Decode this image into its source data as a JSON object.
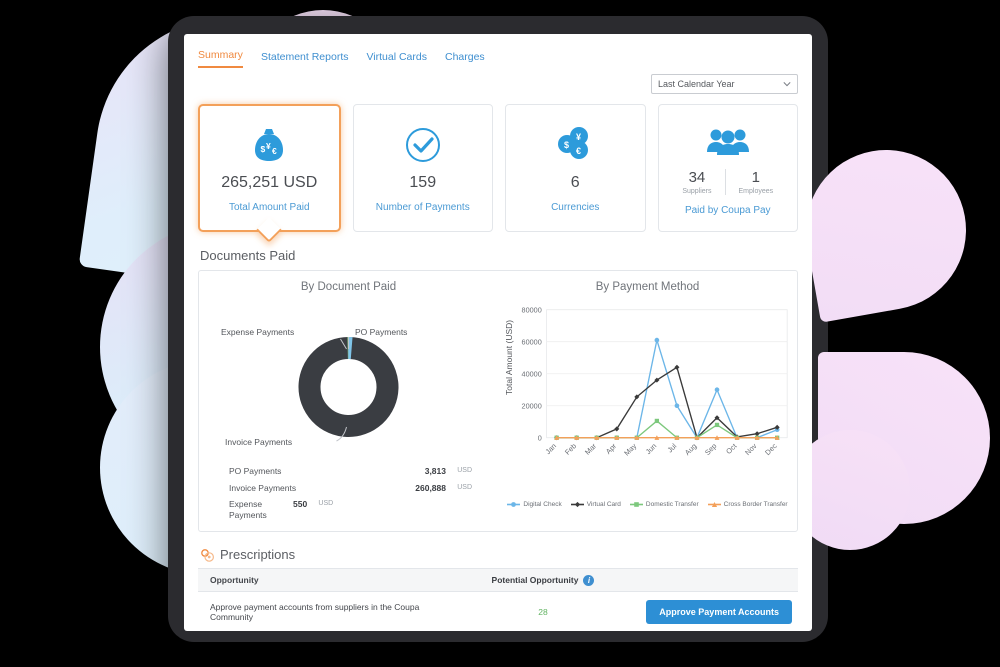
{
  "tabs": [
    {
      "label": "Summary",
      "active": true
    },
    {
      "label": "Statement Reports",
      "active": false
    },
    {
      "label": "Virtual Cards",
      "active": false
    },
    {
      "label": "Charges",
      "active": false
    }
  ],
  "period_select": {
    "value": "Last Calendar Year",
    "icon": "chevron-down-icon"
  },
  "kpis": [
    {
      "icon": "money-bag-icon",
      "value": "265,251 USD",
      "label": "Total Amount Paid",
      "selected": true
    },
    {
      "icon": "check-circle-icon",
      "value": "159",
      "label": "Number of Payments",
      "selected": false
    },
    {
      "icon": "currency-coins-icon",
      "value": "6",
      "label": "Currencies",
      "selected": false
    },
    {
      "icon": "people-group-icon",
      "label": "Paid by Coupa Pay",
      "selected": false,
      "split": [
        {
          "num": "34",
          "caption": "Suppliers"
        },
        {
          "num": "1",
          "caption": "Employees"
        }
      ]
    }
  ],
  "documents_paid": {
    "section_title": "Documents Paid",
    "donut": {
      "title": "By Document Paid",
      "labels": {
        "expense": "Expense Payments",
        "po": "PO Payments",
        "invoice": "Invoice Payments"
      }
    },
    "table": [
      {
        "name": "PO Payments",
        "value": "3,813",
        "currency": "USD"
      },
      {
        "name": "Invoice Payments",
        "value": "260,888",
        "currency": "USD"
      },
      {
        "name": "Expense Payments",
        "value": "550",
        "currency": "USD"
      }
    ]
  },
  "prescriptions": {
    "icon": "prescription-icon",
    "title": "Prescriptions",
    "columns": {
      "opportunity": "Opportunity",
      "potential": "Potential Opportunity",
      "info_icon": "info-icon"
    },
    "rows": [
      {
        "opportunity": "Approve payment accounts from suppliers in the Coupa Community",
        "potential": "28",
        "action": "Approve Payment Accounts"
      }
    ]
  },
  "colors": {
    "accent_orange": "#f08a40",
    "link_blue": "#3f8fd0",
    "icon_blue": "#2d9bdb",
    "digital_check": "#6cb6e8",
    "virtual_card": "#3a3a3a",
    "domestic_transfer": "#7dc87d",
    "cross_border": "#f3a05a",
    "donut_invoice": "#3a3d42",
    "donut_po": "#7fc4e8",
    "donut_expense": "#8fd98f",
    "positive_green": "#63b463"
  },
  "chart_data": {
    "type": "line",
    "title": "By Payment Method",
    "xlabel": "",
    "ylabel": "Total Amount (USD)",
    "categories": [
      "Jan",
      "Feb",
      "Mar",
      "Apr",
      "May",
      "Jun",
      "Jul",
      "Aug",
      "Sep",
      "Oct",
      "Nov",
      "Dec"
    ],
    "ylim": [
      0,
      80000
    ],
    "yticks": [
      0,
      20000,
      40000,
      60000,
      80000
    ],
    "grid": true,
    "legend_position": "bottom",
    "series": [
      {
        "name": "Digital Check",
        "color": "#6cb6e8",
        "marker": "circle",
        "values": [
          0,
          0,
          0,
          0,
          0,
          61000,
          20000,
          0,
          30000,
          0,
          0,
          5000
        ]
      },
      {
        "name": "Virtual Card",
        "color": "#3a3a3a",
        "marker": "diamond",
        "values": [
          0,
          0,
          0,
          5500,
          25500,
          36000,
          44000,
          0,
          12500,
          500,
          2500,
          6500
        ]
      },
      {
        "name": "Domestic Transfer",
        "color": "#7dc87d",
        "marker": "square",
        "values": [
          0,
          0,
          0,
          0,
          0,
          10500,
          0,
          0,
          8000,
          0,
          0,
          0
        ]
      },
      {
        "name": "Cross Border Transfer",
        "color": "#f3a05a",
        "marker": "triangle",
        "values": [
          0,
          0,
          0,
          0,
          0,
          0,
          0,
          0,
          0,
          0,
          0,
          0
        ]
      }
    ]
  },
  "donut_data": {
    "type": "pie",
    "title": "By Document Paid",
    "categories": [
      "PO Payments",
      "Invoice Payments",
      "Expense Payments"
    ],
    "values": [
      3813,
      260888,
      550
    ],
    "colors": [
      "#7fc4e8",
      "#3a3d42",
      "#8fd98f"
    ]
  }
}
